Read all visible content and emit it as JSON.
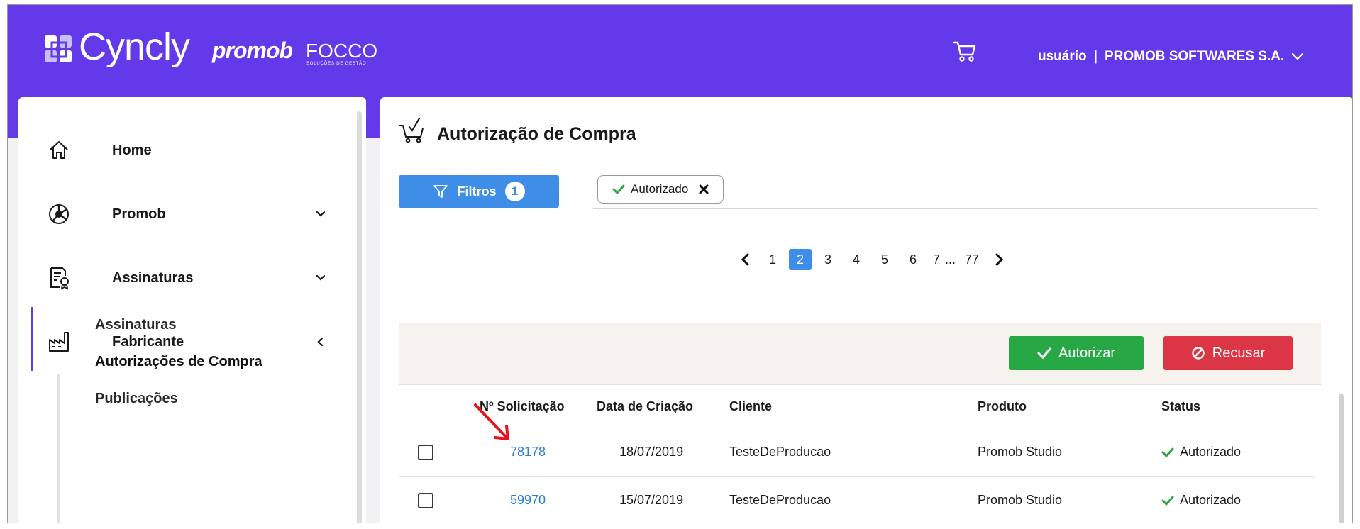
{
  "header": {
    "brand_cyncly": "Cyncly",
    "brand_promob": "promob",
    "brand_focco": "FOCCO",
    "brand_focco_sub": "SOLUÇÕES DE GESTÃO",
    "user_label": "usuário",
    "separator": "|",
    "company": "PROMOB SOFTWARES S.A."
  },
  "sidebar": {
    "items": [
      {
        "label": "Home",
        "icon": "home-icon"
      },
      {
        "label": "Promob",
        "icon": "promob-icon"
      },
      {
        "label": "Assinaturas",
        "icon": "document-certificate-icon"
      },
      {
        "label": "Fabricante",
        "icon": "factory-icon"
      }
    ],
    "sub_items": [
      {
        "label": "Assinaturas"
      },
      {
        "label": "Autorizações de Compra"
      },
      {
        "label": "Publicações"
      }
    ]
  },
  "main": {
    "title": "Autorização de Compra",
    "filter_button": {
      "label": "Filtros",
      "count": "1"
    },
    "active_filter_chip": {
      "label": "Autorizado"
    },
    "pagination": {
      "pages": [
        "1",
        "2",
        "3",
        "4",
        "5",
        "6",
        "7"
      ],
      "ellipsis": "...",
      "last": "77",
      "current": "2"
    },
    "actions": {
      "authorize_label": "Autorizar",
      "refuse_label": "Recusar"
    },
    "table": {
      "headers": {
        "request_no": "Nº Solicitação",
        "created": "Data de Criação",
        "client": "Cliente",
        "product": "Produto",
        "status": "Status"
      },
      "rows": [
        {
          "request_no": "78178",
          "created": "18/07/2019",
          "client": "TesteDeProducao",
          "product": "Promob Studio",
          "status": "Autorizado"
        },
        {
          "request_no": "59970",
          "created": "15/07/2019",
          "client": "TesteDeProducao",
          "product": "Promob Studio",
          "status": "Autorizado"
        }
      ]
    }
  },
  "colors": {
    "header_bg": "#6339ea",
    "primary_blue": "#3e8ee8",
    "success_green": "#28a745",
    "danger_red": "#dc3545",
    "link_blue": "#2a7fd1",
    "annotation_arrow": "#e8141c"
  }
}
